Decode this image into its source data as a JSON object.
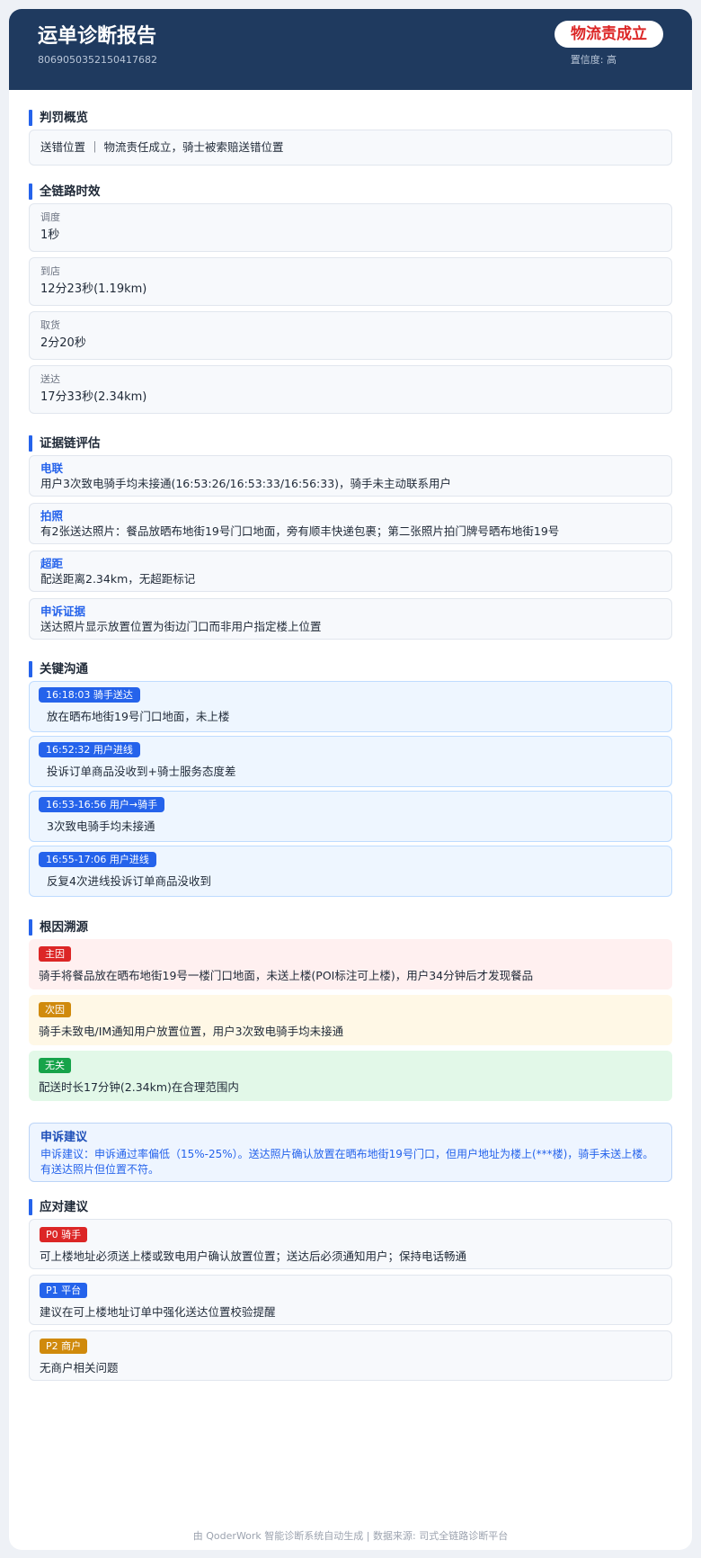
{
  "header": {
    "title": "运单诊断报告",
    "order_id": "8069050352150417682",
    "verdict": "物流责成立",
    "confidence": "置信度: 高"
  },
  "sections": {
    "overview": "判罚概览",
    "timing": "全链路时效",
    "evidence": "证据链评估",
    "communication": "关键沟通",
    "root_cause": "根因溯源",
    "actions": "应对建议"
  },
  "overview": {
    "text": "送错位置 ｜ 物流责任成立，骑士被索赔送错位置"
  },
  "timing": [
    {
      "label": "调度",
      "value": "1秒"
    },
    {
      "label": "到店",
      "value": "12分23秒(1.19km)"
    },
    {
      "label": "取货",
      "value": "2分20秒"
    },
    {
      "label": "送达",
      "value": "17分33秒(2.34km)"
    }
  ],
  "evidence": [
    {
      "label": "电联",
      "desc": "用户3次致电骑手均未接通(16:53:26/16:53:33/16:56:33)，骑手未主动联系用户"
    },
    {
      "label": "拍照",
      "desc": "有2张送达照片：餐品放晒布地街19号门口地面，旁有顺丰快递包裹；第二张照片拍门牌号晒布地街19号"
    },
    {
      "label": "超距",
      "desc": "配送距离2.34km，无超距标记"
    },
    {
      "label": "申诉证据",
      "desc": "送达照片显示放置位置为街边门口而非用户指定楼上位置"
    }
  ],
  "communication": [
    {
      "tag": "16:18:03  骑手送达",
      "text": "放在晒布地街19号门口地面，未上楼"
    },
    {
      "tag": "16:52:32  用户进线",
      "text": "投诉订单商品没收到+骑士服务态度差"
    },
    {
      "tag": "16:53-16:56  用户→骑手",
      "text": "3次致电骑手均未接通"
    },
    {
      "tag": "16:55-17:06  用户进线",
      "text": "反复4次进线投诉订单商品没收到"
    }
  ],
  "root_causes": [
    {
      "tag": "主因",
      "text": "骑手将餐品放在晒布地街19号一楼门口地面，未送上楼(POI标注可上楼)，用户34分钟后才发现餐品",
      "tag_color": "#dc2626"
    },
    {
      "tag": "次因",
      "text": "骑手未致电/IM通知用户放置位置，用户3次致电骑手均未接通",
      "tag_color": "#d08a0c"
    },
    {
      "tag": "无关",
      "text": "配送时长17分钟(2.34km)在合理范围内",
      "tag_color": "#16a34a"
    }
  ],
  "appeal": {
    "label": "申诉建议",
    "text": "申诉建议：申诉通过率偏低（15%-25%）。送达照片确认放置在晒布地街19号门口，但用户地址为楼上(***楼)，骑手未送上楼。有送达照片但位置不符。"
  },
  "actions": [
    {
      "tag": "P0 骑手",
      "text": "可上楼地址必须送上楼或致电用户确认放置位置；送达后必须通知用户；保持电话畅通",
      "tag_color": "#dc2626"
    },
    {
      "tag": "P1 平台",
      "text": "建议在可上楼地址订单中强化送达位置校验提醒",
      "tag_color": "#2563eb"
    },
    {
      "tag": "P2 商户",
      "text": "无商户相关问题",
      "tag_color": "#d08a0c"
    }
  ],
  "footer": "由 QoderWork 智能诊断系统自动生成 | 数据来源: 司式全链路诊断平台",
  "colors": {
    "header_bg": "#1f3a5f",
    "accent": "#2563eb",
    "verdict": "#dc2626"
  }
}
